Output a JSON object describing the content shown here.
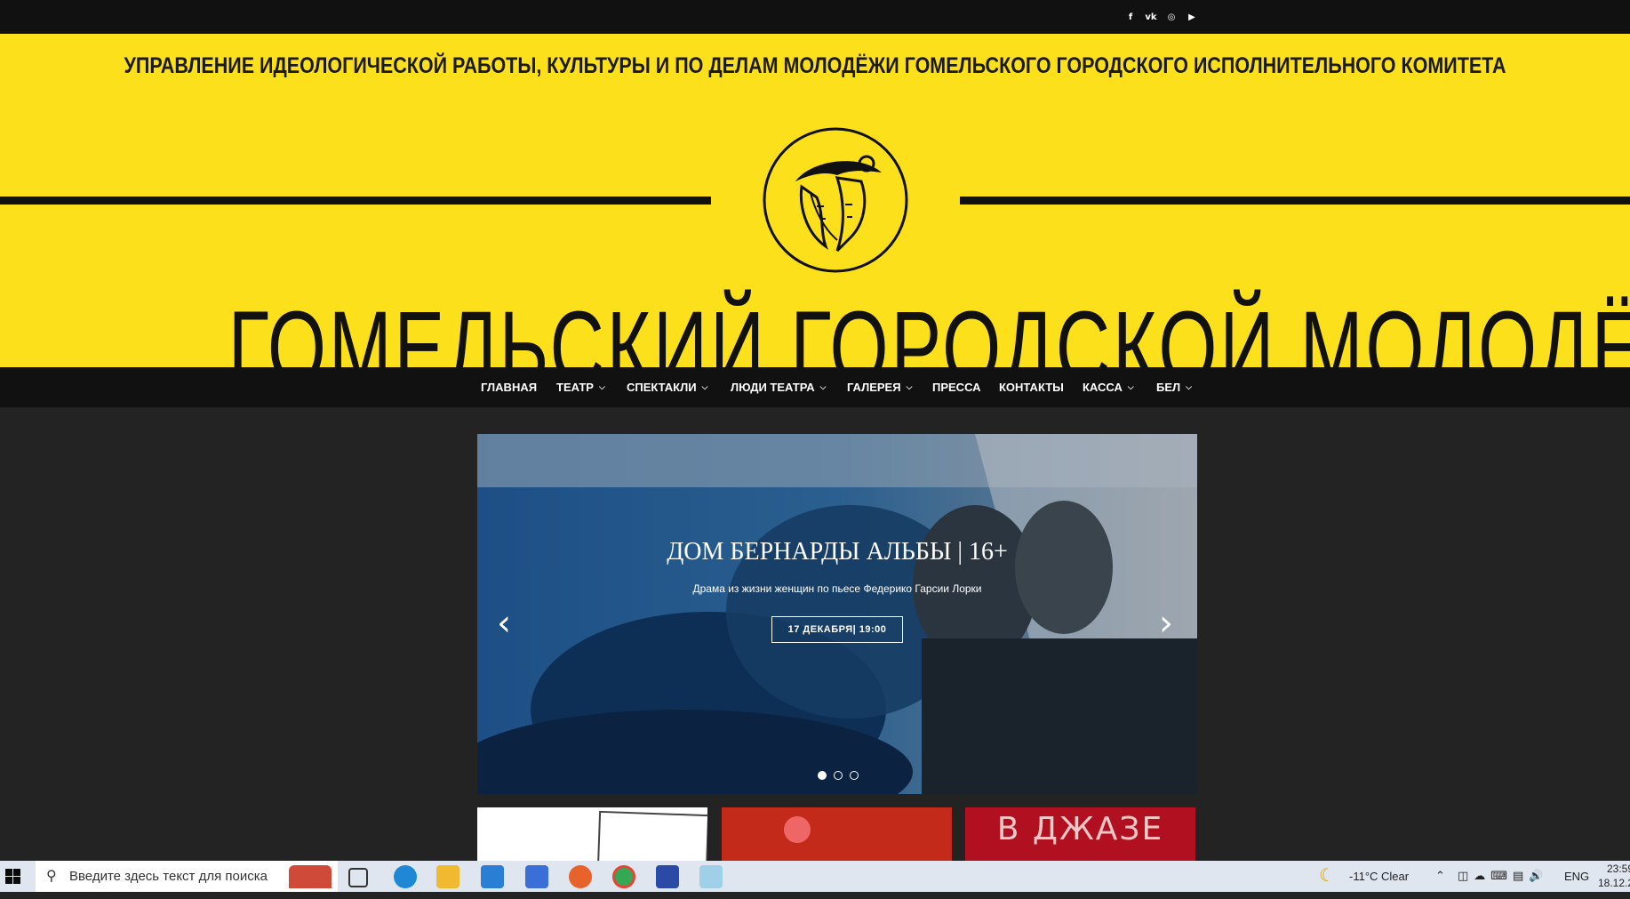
{
  "social": {
    "icons": [
      "facebook-icon",
      "vk-icon",
      "instagram-icon",
      "youtube-icon"
    ],
    "glyphs": [
      "f",
      "vk",
      "◎",
      "▶"
    ]
  },
  "header": {
    "gov_text": "УПРАВЛЕНИЕ ИДЕОЛОГИЧЕСКОЙ РАБОТЫ, КУЛЬТУРЫ И ПО ДЕЛАМ МОЛОДЁЖИ ГОМЕЛЬСКОГО ГОРОДСКОГО ИСПОЛНИТЕЛЬНОГО КОМИТЕТА",
    "title": "ГОМЕЛЬСКИЙ ГОРОДСКОЙ МОЛОДЁЖНЫЙ ТЕАТР",
    "background": "#fde01c"
  },
  "nav": {
    "items": [
      {
        "label": "ГЛАВНАЯ",
        "dropdown": false
      },
      {
        "label": "ТЕАТР",
        "dropdown": true
      },
      {
        "label": "СПЕКТАКЛИ",
        "dropdown": true
      },
      {
        "label": "ЛЮДИ ТЕАТРА",
        "dropdown": true
      },
      {
        "label": "ГАЛЕРЕЯ",
        "dropdown": true
      },
      {
        "label": "ПРЕССА",
        "dropdown": false
      },
      {
        "label": "КОНТАКТЫ",
        "dropdown": false
      },
      {
        "label": "КАССА",
        "dropdown": true
      },
      {
        "label": "БЕЛ",
        "dropdown": true
      }
    ]
  },
  "slider": {
    "title": "ДОМ БЕРНАРДЫ АЛЬБЫ | 16+",
    "subtitle": "Драма из жизни женщин по пьесе Федерико Гарсии Лорки",
    "button": "17 ДЕКАБРЯ| 19:00",
    "dots": 3,
    "active_dot": 1
  },
  "thumbs": {
    "third_text": "В ДЖАЗЕ"
  },
  "taskbar": {
    "search_placeholder": "Введите здесь текст для поиска",
    "weather": "-11°C  Clear",
    "lang": "ENG",
    "time": "23:59",
    "date": "18.12.2"
  }
}
